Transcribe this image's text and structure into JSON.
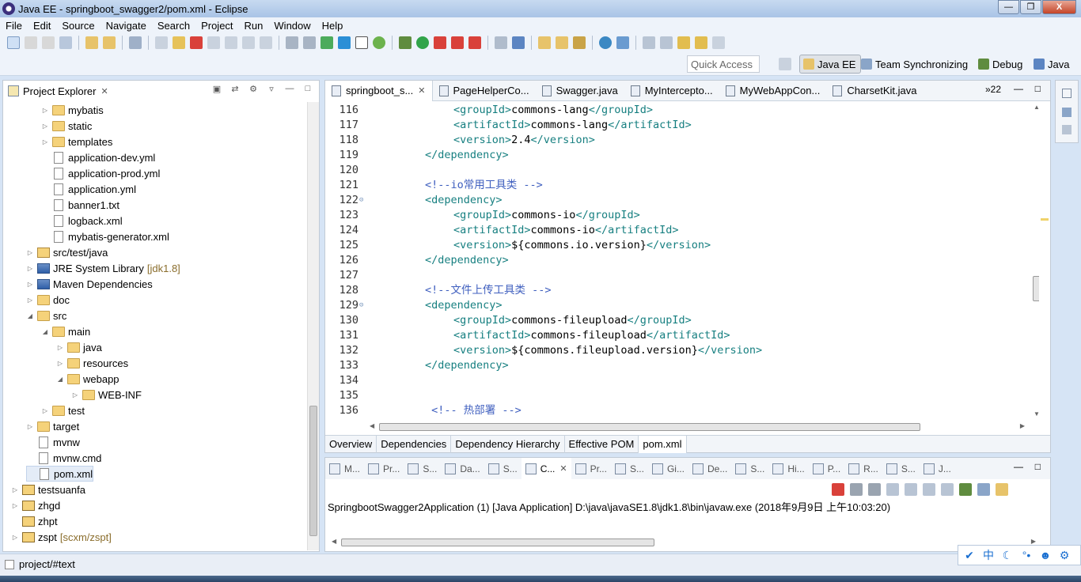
{
  "window": {
    "title": "Java EE - springboot_swagger2/pom.xml - Eclipse",
    "buttons": [
      "—",
      "❐",
      "X"
    ]
  },
  "menu": [
    "File",
    "Edit",
    "Source",
    "Navigate",
    "Search",
    "Project",
    "Run",
    "Window",
    "Help"
  ],
  "quick_access": {
    "placeholder": "Quick Access"
  },
  "perspectives": [
    {
      "label": "Java EE",
      "active": true
    },
    {
      "label": "Team Synchronizing",
      "active": false
    },
    {
      "label": "Debug",
      "active": false
    },
    {
      "label": "Java",
      "active": false
    }
  ],
  "project_explorer": {
    "title": "Project Explorer",
    "close": "✕",
    "items": [
      {
        "label": "mybatis",
        "type": "folder",
        "indent": 2,
        "arrow": "▷"
      },
      {
        "label": "static",
        "type": "folder",
        "indent": 2,
        "arrow": "▷"
      },
      {
        "label": "templates",
        "type": "folder",
        "indent": 2,
        "arrow": "▷"
      },
      {
        "label": "application-dev.yml",
        "type": "file",
        "indent": 2,
        "arrow": ""
      },
      {
        "label": "application-prod.yml",
        "type": "file",
        "indent": 2,
        "arrow": ""
      },
      {
        "label": "application.yml",
        "type": "file",
        "indent": 2,
        "arrow": ""
      },
      {
        "label": "banner1.txt",
        "type": "file",
        "indent": 2,
        "arrow": ""
      },
      {
        "label": "logback.xml",
        "type": "xml",
        "indent": 2,
        "arrow": ""
      },
      {
        "label": "mybatis-generator.xml",
        "type": "xml",
        "indent": 2,
        "arrow": ""
      },
      {
        "label": "src/test/java",
        "type": "pkgfolder",
        "indent": 1,
        "arrow": "▷"
      },
      {
        "label": "JRE System Library",
        "type": "lib",
        "indent": 1,
        "arrow": "▷",
        "deco": "[jdk1.8]"
      },
      {
        "label": "Maven Dependencies",
        "type": "lib",
        "indent": 1,
        "arrow": "▷"
      },
      {
        "label": "doc",
        "type": "folder",
        "indent": 1,
        "arrow": "▷"
      },
      {
        "label": "src",
        "type": "folder",
        "indent": 1,
        "arrow": "◢"
      },
      {
        "label": "main",
        "type": "folder",
        "indent": 2,
        "arrow": "◢"
      },
      {
        "label": "java",
        "type": "folder",
        "indent": 3,
        "arrow": "▷"
      },
      {
        "label": "resources",
        "type": "folder",
        "indent": 3,
        "arrow": "▷"
      },
      {
        "label": "webapp",
        "type": "folder",
        "indent": 3,
        "arrow": "◢"
      },
      {
        "label": "WEB-INF",
        "type": "folder",
        "indent": 4,
        "arrow": "▷"
      },
      {
        "label": "test",
        "type": "folder",
        "indent": 2,
        "arrow": "▷"
      },
      {
        "label": "target",
        "type": "folder",
        "indent": 1,
        "arrow": "▷"
      },
      {
        "label": "mvnw",
        "type": "file",
        "indent": 1,
        "arrow": ""
      },
      {
        "label": "mvnw.cmd",
        "type": "file",
        "indent": 1,
        "arrow": ""
      },
      {
        "label": "pom.xml",
        "type": "xml",
        "indent": 1,
        "arrow": "",
        "selected": true
      },
      {
        "label": "testsuanfa",
        "type": "proj",
        "indent": 0,
        "arrow": "▷"
      },
      {
        "label": "zhgd",
        "type": "proj",
        "indent": 0,
        "arrow": "▷"
      },
      {
        "label": "zhpt",
        "type": "proj",
        "indent": 0,
        "arrow": ""
      },
      {
        "label": "zspt",
        "type": "proj",
        "indent": 0,
        "arrow": "▷",
        "deco": "[scxm/zspt]"
      }
    ]
  },
  "editor": {
    "tabs": [
      {
        "label": "springboot_s...",
        "active": true,
        "close": "✕"
      },
      {
        "label": "PageHelperCo...",
        "active": false
      },
      {
        "label": "Swagger.java",
        "active": false
      },
      {
        "label": "MyIntercepto...",
        "active": false
      },
      {
        "label": "MyWebAppCon...",
        "active": false
      },
      {
        "label": "CharsetKit.java",
        "active": false
      }
    ],
    "overflow": "»22",
    "lines": [
      {
        "n": "116",
        "indent": 2,
        "parts": [
          [
            "tag",
            "<groupId>"
          ],
          [
            "txt",
            "commons-lang"
          ],
          [
            "tag",
            "</groupId>"
          ]
        ]
      },
      {
        "n": "117",
        "indent": 2,
        "parts": [
          [
            "tag",
            "<artifactId>"
          ],
          [
            "txt",
            "commons-lang"
          ],
          [
            "tag",
            "</artifactId>"
          ]
        ]
      },
      {
        "n": "118",
        "indent": 2,
        "parts": [
          [
            "tag",
            "<version>"
          ],
          [
            "txt",
            "2.4"
          ],
          [
            "tag",
            "</version>"
          ]
        ]
      },
      {
        "n": "119",
        "indent": 1,
        "parts": [
          [
            "tag",
            "</dependency>"
          ]
        ]
      },
      {
        "n": "120",
        "indent": 0,
        "parts": []
      },
      {
        "n": "121",
        "indent": 1,
        "parts": [
          [
            "cmt",
            "<!--io常用工具类 -->"
          ]
        ]
      },
      {
        "n": "122",
        "indent": 1,
        "fold": "⊝",
        "parts": [
          [
            "tag",
            "<dependency>"
          ]
        ]
      },
      {
        "n": "123",
        "indent": 2,
        "parts": [
          [
            "tag",
            "<groupId>"
          ],
          [
            "txt",
            "commons-io"
          ],
          [
            "tag",
            "</groupId>"
          ]
        ]
      },
      {
        "n": "124",
        "indent": 2,
        "parts": [
          [
            "tag",
            "<artifactId>"
          ],
          [
            "txt",
            "commons-io"
          ],
          [
            "tag",
            "</artifactId>"
          ]
        ]
      },
      {
        "n": "125",
        "indent": 2,
        "parts": [
          [
            "tag",
            "<version>"
          ],
          [
            "txt",
            "${commons.io.version}"
          ],
          [
            "tag",
            "</version>"
          ]
        ]
      },
      {
        "n": "126",
        "indent": 1,
        "parts": [
          [
            "tag",
            "</dependency>"
          ]
        ]
      },
      {
        "n": "127",
        "indent": 0,
        "parts": []
      },
      {
        "n": "128",
        "indent": 1,
        "parts": [
          [
            "cmt",
            "<!--文件上传工具类 -->"
          ]
        ]
      },
      {
        "n": "129",
        "indent": 1,
        "fold": "⊝",
        "parts": [
          [
            "tag",
            "<dependency>"
          ]
        ]
      },
      {
        "n": "130",
        "indent": 2,
        "parts": [
          [
            "tag",
            "<groupId>"
          ],
          [
            "txt",
            "commons-fileupload"
          ],
          [
            "tag",
            "</groupId>"
          ]
        ]
      },
      {
        "n": "131",
        "indent": 2,
        "parts": [
          [
            "tag",
            "<artifactId>"
          ],
          [
            "txt",
            "commons-fileupload"
          ],
          [
            "tag",
            "</artifactId>"
          ]
        ]
      },
      {
        "n": "132",
        "indent": 2,
        "parts": [
          [
            "tag",
            "<version>"
          ],
          [
            "txt",
            "${commons.fileupload.version}"
          ],
          [
            "tag",
            "</version>"
          ]
        ]
      },
      {
        "n": "133",
        "indent": 1,
        "parts": [
          [
            "tag",
            "</dependency>"
          ]
        ]
      },
      {
        "n": "134",
        "indent": 0,
        "parts": []
      },
      {
        "n": "135",
        "indent": 0,
        "parts": []
      },
      {
        "n": "136",
        "indent": 1,
        "parts": [
          [
            "cmt",
            " <!-- 热部署 -->"
          ]
        ]
      }
    ],
    "pom_tabs": [
      {
        "label": "Overview",
        "active": false
      },
      {
        "label": "Dependencies",
        "active": false
      },
      {
        "label": "Dependency Hierarchy",
        "active": false
      },
      {
        "label": "Effective POM",
        "active": false
      },
      {
        "label": "pom.xml",
        "active": true
      }
    ]
  },
  "console": {
    "tabs": [
      {
        "label": "M...",
        "active": false
      },
      {
        "label": "Pr...",
        "active": false
      },
      {
        "label": "S...",
        "active": false
      },
      {
        "label": "Da...",
        "active": false
      },
      {
        "label": "S...",
        "active": false
      },
      {
        "label": "C...",
        "active": true
      },
      {
        "label": "Pr...",
        "active": false
      },
      {
        "label": "S...",
        "active": false
      },
      {
        "label": "Gi...",
        "active": false
      },
      {
        "label": "De...",
        "active": false
      },
      {
        "label": "S...",
        "active": false
      },
      {
        "label": "Hi...",
        "active": false
      },
      {
        "label": "P...",
        "active": false
      },
      {
        "label": "R...",
        "active": false
      },
      {
        "label": "S...",
        "active": false
      },
      {
        "label": "J...",
        "active": false
      }
    ],
    "close": "✕",
    "launch_text": "SpringbootSwagger2Application (1) [Java Application] D:\\java\\javaSE1.8\\jdk1.8\\bin\\javaw.exe (2018年9月9日 上午10:03:20)"
  },
  "statusbar": {
    "text": "project/#text"
  },
  "ime": [
    "✔",
    "中",
    "☾",
    "°•",
    "☻",
    "⚙"
  ],
  "colors": {
    "tag": "#167f80",
    "comment": "#3f5fbf",
    "accent": "#1a6fd1"
  }
}
